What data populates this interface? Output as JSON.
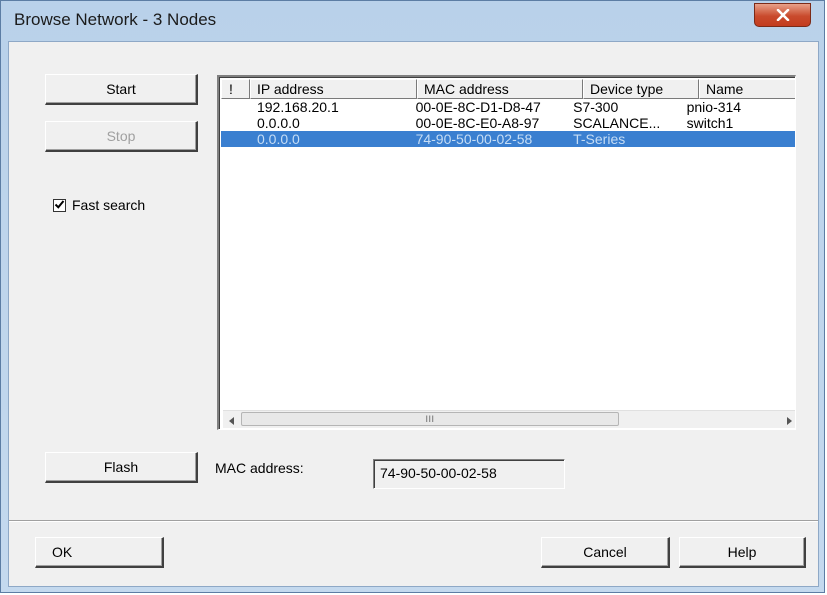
{
  "window": {
    "title": "Browse Network - 3 Nodes"
  },
  "buttons": {
    "start": "Start",
    "stop": "Stop",
    "flash": "Flash",
    "ok": "OK",
    "cancel": "Cancel",
    "help": "Help"
  },
  "fast_search": {
    "label": "Fast search",
    "checked": true
  },
  "table": {
    "columns": [
      "!",
      "IP address",
      "MAC address",
      "Device type",
      "Name"
    ],
    "rows": [
      {
        "flag": "",
        "ip": "192.168.20.1",
        "mac": "00-0E-8C-D1-D8-47",
        "type": "S7-300",
        "name": "pnio-314",
        "selected": false
      },
      {
        "flag": "",
        "ip": "0.0.0.0",
        "mac": "00-0E-8C-E0-A8-97",
        "type": "SCALANCE...",
        "name": "switch1",
        "selected": false
      },
      {
        "flag": "",
        "ip": "0.0.0.0",
        "mac": "74-90-50-00-02-58",
        "type": "T-Series",
        "name": "",
        "selected": true
      }
    ],
    "scroll_thumb_glyph": "III"
  },
  "mac_field": {
    "label": "MAC address:",
    "value": "74-90-50-00-02-58"
  },
  "icons": {
    "close": "close-icon",
    "check": "checkmark-icon",
    "scroll_left": "arrow-left-icon",
    "scroll_right": "arrow-right-icon"
  }
}
